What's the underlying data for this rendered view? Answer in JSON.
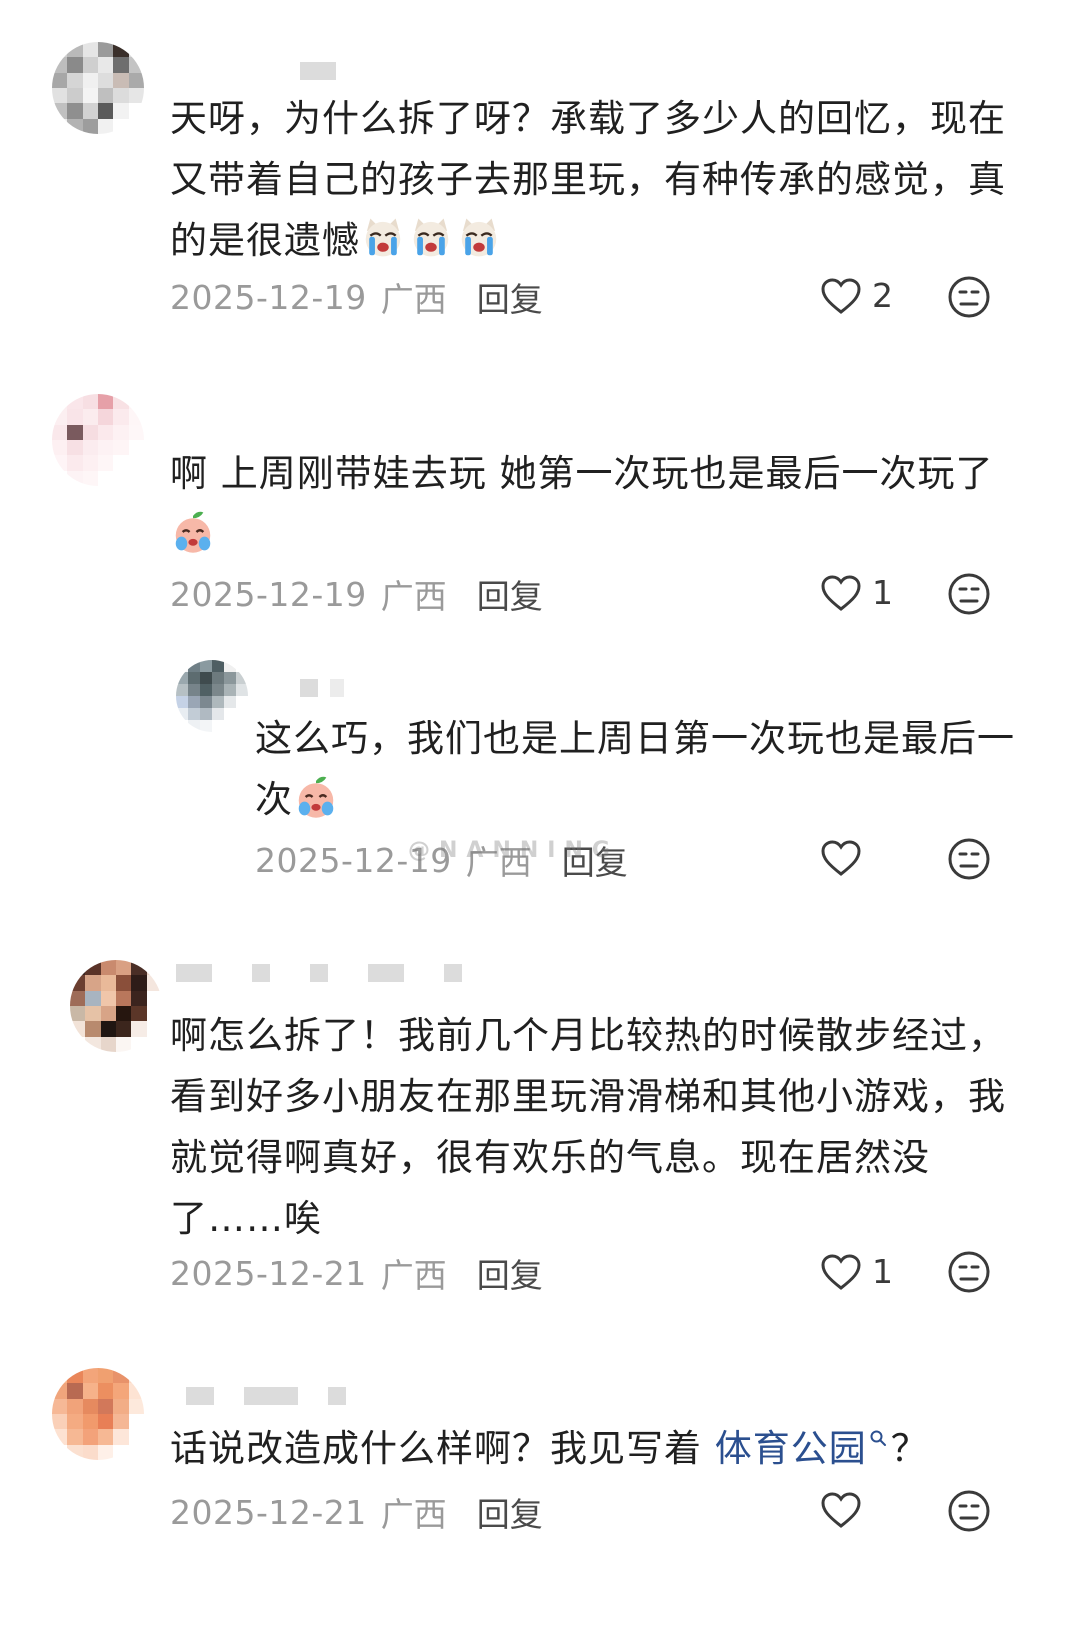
{
  "watermark": "@NANNING",
  "comments": [
    {
      "text_lines": [
        "天呀，为什么拆了呀？承载了多少人的回忆，现在",
        "又带着自己的孩子去那里玩，有种传承的感觉，真",
        "的是很遗憾"
      ],
      "emojis": [
        "crying-dog-icon",
        "crying-dog-icon",
        "crying-dog-icon"
      ],
      "date": "2025-12-19",
      "location": "广西",
      "reply_label": "回复",
      "likes": "2"
    },
    {
      "text_lines": [
        "啊 上周刚带娃去玩 她第一次玩也是最后一次玩了"
      ],
      "emojis": [
        "crying-peach-icon"
      ],
      "date": "2025-12-19",
      "location": "广西",
      "reply_label": "回复",
      "likes": "1"
    },
    {
      "text_lines": [
        "这么巧，我们也是上周日第一次玩也是最后一",
        "次"
      ],
      "emojis": [
        "crying-peach-icon"
      ],
      "date": "2025-12-19",
      "location": "广西",
      "reply_label": "回复",
      "likes": ""
    },
    {
      "text_lines": [
        "啊怎么拆了！我前几个月比较热的时候散步经过，",
        "看到好多小朋友在那里玩滑滑梯和其他小游戏，我",
        "就觉得啊真好，很有欢乐的气息。现在居然没",
        "了……唉"
      ],
      "emojis": [],
      "date": "2025-12-21",
      "location": "广西",
      "reply_label": "回复",
      "likes": "1"
    },
    {
      "text_prefix": "话说改造成什么样啊？我见写着 ",
      "link_text": "体育公园",
      "text_suffix": "？",
      "emojis": [],
      "date": "2025-12-21",
      "location": "广西",
      "reply_label": "回复",
      "likes": ""
    }
  ],
  "colors": {
    "link": "#2b4f8f",
    "meta": "#9a9a9a",
    "text": "#202020"
  }
}
